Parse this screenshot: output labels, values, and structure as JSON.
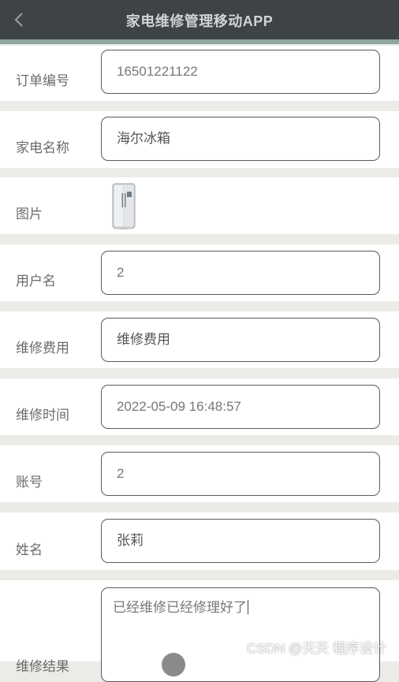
{
  "header": {
    "title": "家电维修管理移动APP",
    "back_icon": "chevron-left-icon"
  },
  "form": {
    "order_no": {
      "label": "订单编号",
      "value": "16501221122"
    },
    "appliance": {
      "label": "家电名称",
      "value": "海尔冰箱"
    },
    "image": {
      "label": "图片",
      "icon": "refrigerator-image"
    },
    "username": {
      "label": "用户名",
      "value": "2"
    },
    "fee": {
      "label": "维修费用",
      "value": "维修费用"
    },
    "time": {
      "label": "维修时间",
      "value": "2022-05-09 16:48:57"
    },
    "account": {
      "label": "账号",
      "value": "2"
    },
    "name": {
      "label": "姓名",
      "value": "张莉"
    },
    "result": {
      "label": "维修结果",
      "value": "已经维修已经修理好了"
    }
  },
  "watermark": "CSDN @天天 程序设计",
  "colors": {
    "header_bg": "#3e4346",
    "header_accent": "#8fa6a1",
    "page_bg": "#ecebe7"
  }
}
